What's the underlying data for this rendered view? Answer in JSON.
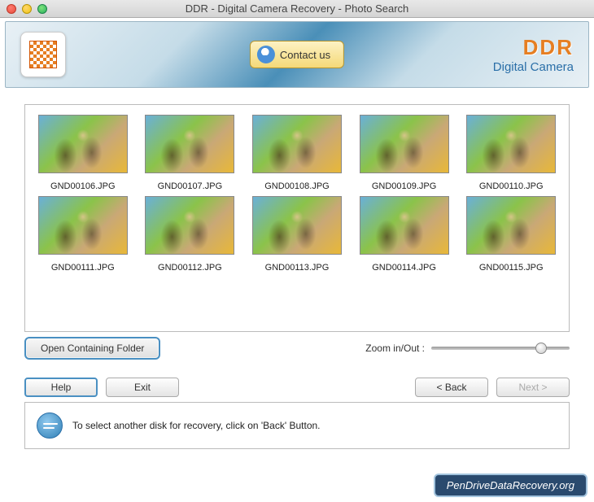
{
  "window": {
    "title": "DDR - Digital Camera Recovery - Photo Search"
  },
  "header": {
    "contact_label": "Contact us",
    "brand_main": "DDR",
    "brand_sub": "Digital Camera"
  },
  "thumbnails": [
    {
      "filename": "GND00106.JPG"
    },
    {
      "filename": "GND00107.JPG"
    },
    {
      "filename": "GND00108.JPG"
    },
    {
      "filename": "GND00109.JPG"
    },
    {
      "filename": "GND00110.JPG"
    },
    {
      "filename": "GND00111.JPG"
    },
    {
      "filename": "GND00112.JPG"
    },
    {
      "filename": "GND00113.JPG"
    },
    {
      "filename": "GND00114.JPG"
    },
    {
      "filename": "GND00115.JPG"
    }
  ],
  "controls": {
    "open_folder": "Open Containing Folder",
    "zoom_label": "Zoom in/Out :"
  },
  "nav": {
    "help": "Help",
    "exit": "Exit",
    "back": "< Back",
    "next": "Next >"
  },
  "hint": {
    "text": "To select another disk for recovery, click on 'Back' Button."
  },
  "watermark": "PenDriveDataRecovery.org"
}
